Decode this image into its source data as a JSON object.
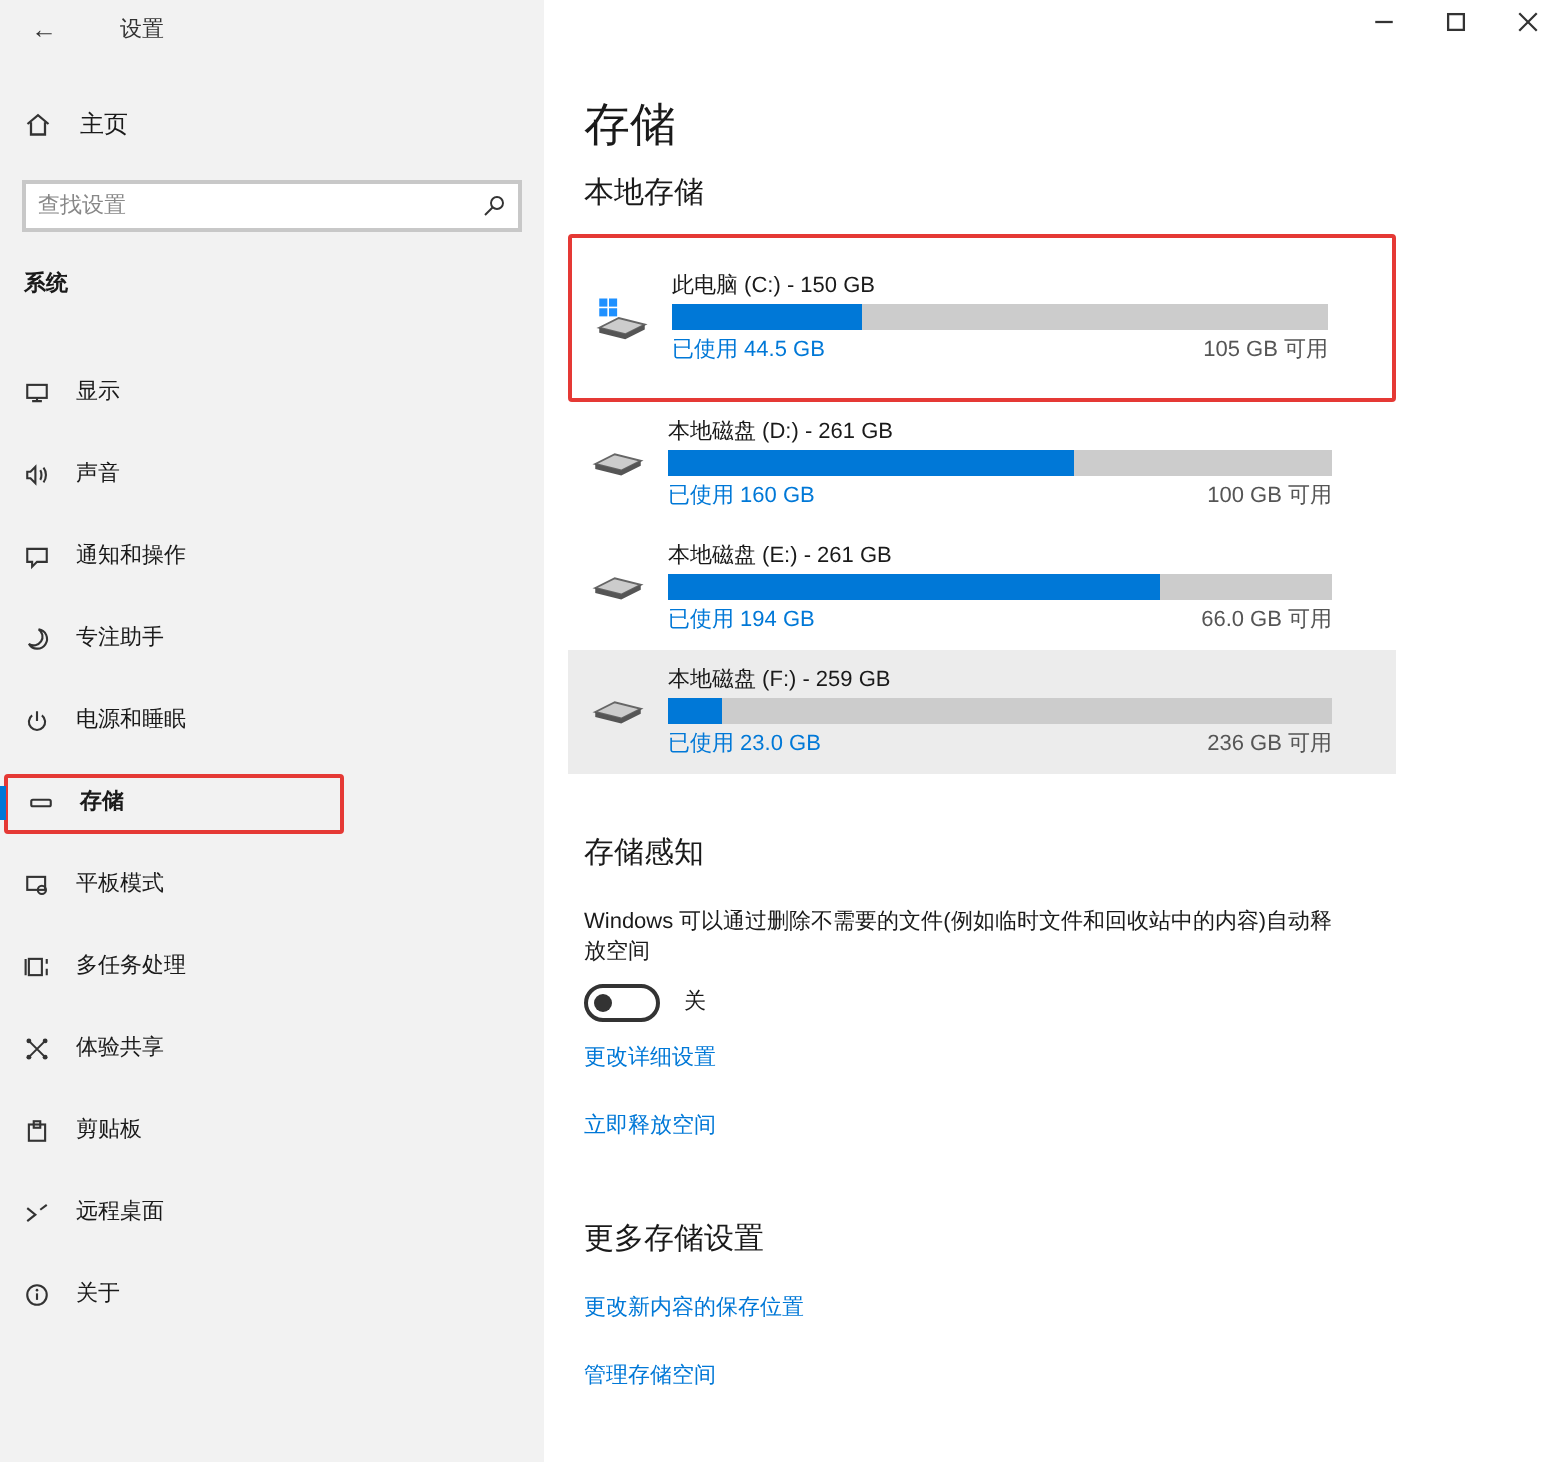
{
  "window": {
    "title": "设置",
    "back_glyph": "←"
  },
  "sidebar": {
    "home": "主页",
    "search": {
      "placeholder": "查找设置"
    },
    "section": "系统",
    "items": [
      {
        "label": "显示",
        "selected": false,
        "annotated": false
      },
      {
        "label": "声音",
        "selected": false,
        "annotated": false
      },
      {
        "label": "通知和操作",
        "selected": false,
        "annotated": false
      },
      {
        "label": "专注助手",
        "selected": false,
        "annotated": false
      },
      {
        "label": "电源和睡眠",
        "selected": false,
        "annotated": false
      },
      {
        "label": "存储",
        "selected": true,
        "annotated": true
      },
      {
        "label": "平板模式",
        "selected": false,
        "annotated": false
      },
      {
        "label": "多任务处理",
        "selected": false,
        "annotated": false
      },
      {
        "label": "体验共享",
        "selected": false,
        "annotated": false
      },
      {
        "label": "剪贴板",
        "selected": false,
        "annotated": false
      },
      {
        "label": "远程桌面",
        "selected": false,
        "annotated": false
      },
      {
        "label": "关于",
        "selected": false,
        "annotated": false
      }
    ]
  },
  "page": {
    "title": "存储",
    "local_heading": "本地存储",
    "drives": [
      {
        "name": "此电脑 (C:) - 150 GB",
        "system": true,
        "level": 0.29,
        "used": "已使用 44.5 GB",
        "free": "105 GB 可用",
        "annotated": true,
        "hovered": false
      },
      {
        "name": "本地磁盘 (D:) - 261 GB",
        "system": false,
        "level": 0.61,
        "used": "已使用 160 GB",
        "free": "100 GB 可用",
        "annotated": false,
        "hovered": false
      },
      {
        "name": "本地磁盘 (E:) - 261 GB",
        "system": false,
        "level": 0.74,
        "used": "已使用 194 GB",
        "free": "66.0 GB 可用",
        "annotated": false,
        "hovered": false
      },
      {
        "name": "本地磁盘 (F:) - 259 GB",
        "system": false,
        "level": 0.08,
        "used": "已使用 23.0 GB",
        "free": "236 GB 可用",
        "annotated": false,
        "hovered": true
      }
    ],
    "sense": {
      "heading": "存储感知",
      "description": "Windows 可以通过删除不需要的文件(例如临时文件和回收站中的内容)自动释放空间",
      "toggle": {
        "on": false,
        "label": "关"
      },
      "links": [
        "更改详细设置",
        "立即释放空间"
      ]
    },
    "more": {
      "heading": "更多存储设置",
      "links": [
        "更改新内容的保存位置",
        "管理存储空间"
      ]
    }
  }
}
